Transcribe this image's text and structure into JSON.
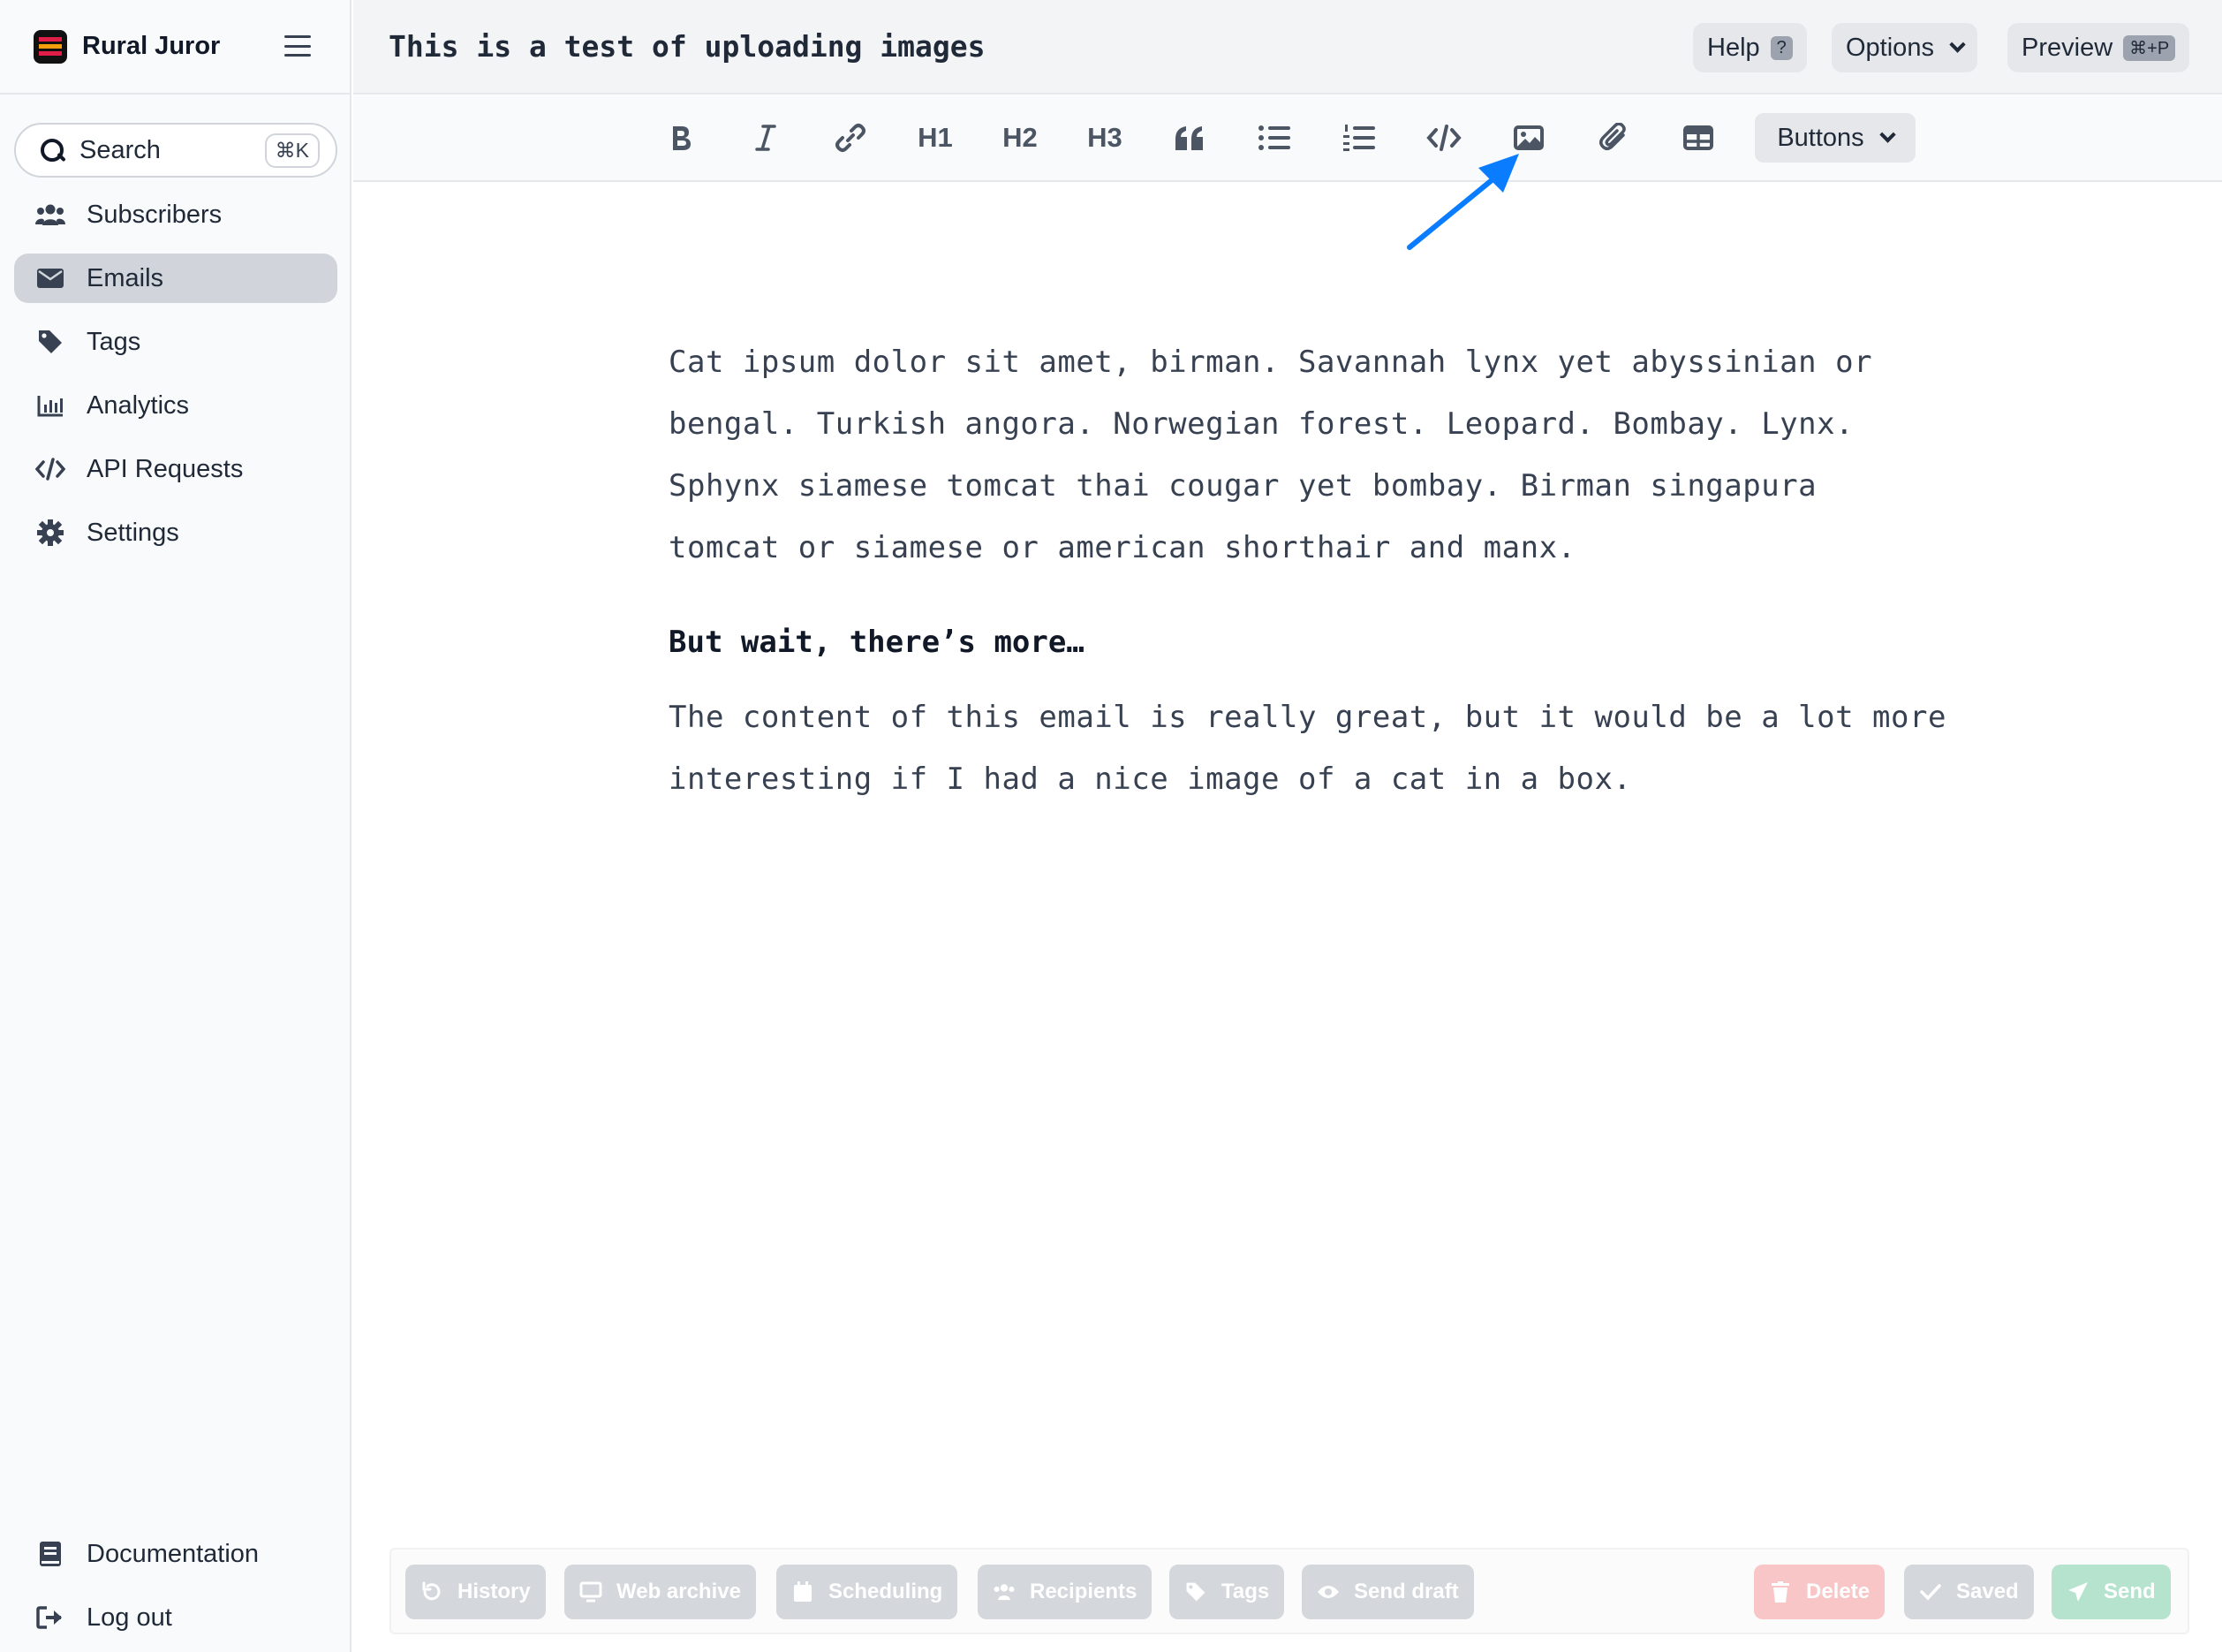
{
  "brand": {
    "name": "Rural Juror"
  },
  "search": {
    "label": "Search",
    "shortcut": "⌘K"
  },
  "sidebar": {
    "items": [
      {
        "label": "Subscribers",
        "icon": "users-icon"
      },
      {
        "label": "Emails",
        "icon": "envelope-icon",
        "active": true
      },
      {
        "label": "Tags",
        "icon": "tag-icon"
      },
      {
        "label": "Analytics",
        "icon": "chart-icon"
      },
      {
        "label": "API Requests",
        "icon": "code-icon"
      },
      {
        "label": "Settings",
        "icon": "gear-icon"
      }
    ],
    "bottom": [
      {
        "label": "Documentation",
        "icon": "book-icon"
      },
      {
        "label": "Log out",
        "icon": "logout-icon"
      }
    ]
  },
  "header": {
    "title": "This is a test of uploading images",
    "help_label": "Help",
    "help_badge": "?",
    "options_label": "Options",
    "preview_label": "Preview",
    "preview_badge": "⌘+P"
  },
  "toolbar": {
    "h1": "H1",
    "h2": "H2",
    "h3": "H3",
    "buttons_label": "Buttons",
    "tools": [
      "bold-icon",
      "italic-icon",
      "link-icon",
      "h1",
      "h2",
      "h3",
      "quote-icon",
      "bullet-list-icon",
      "numbered-list-icon",
      "code-icon",
      "image-icon",
      "attachment-icon",
      "table-icon"
    ]
  },
  "editor": {
    "paragraph1": "Cat ipsum dolor sit amet, birman. Savannah lynx yet abyssinian or bengal. Turkish angora. Norwegian forest. Leopard. Bombay. Lynx. Sphynx siamese tomcat thai cougar yet bombay. Birman singapura tomcat or siamese or american shorthair and manx.",
    "heading": "But wait, there’s more…",
    "paragraph2": "The content of this email is really great, but it would be a lot more interesting if I had a nice image of a cat in a box."
  },
  "actions": {
    "history": "History",
    "web_archive": "Web archive",
    "scheduling": "Scheduling",
    "recipients": "Recipients",
    "tags": "Tags",
    "send_draft": "Send draft",
    "delete": "Delete",
    "saved": "Saved",
    "send": "Send"
  },
  "colors": {
    "annotation_arrow": "#0a7cff",
    "active_nav": "#d1d5db",
    "delete": "#f9c6c8",
    "send": "#b5e3cd"
  }
}
